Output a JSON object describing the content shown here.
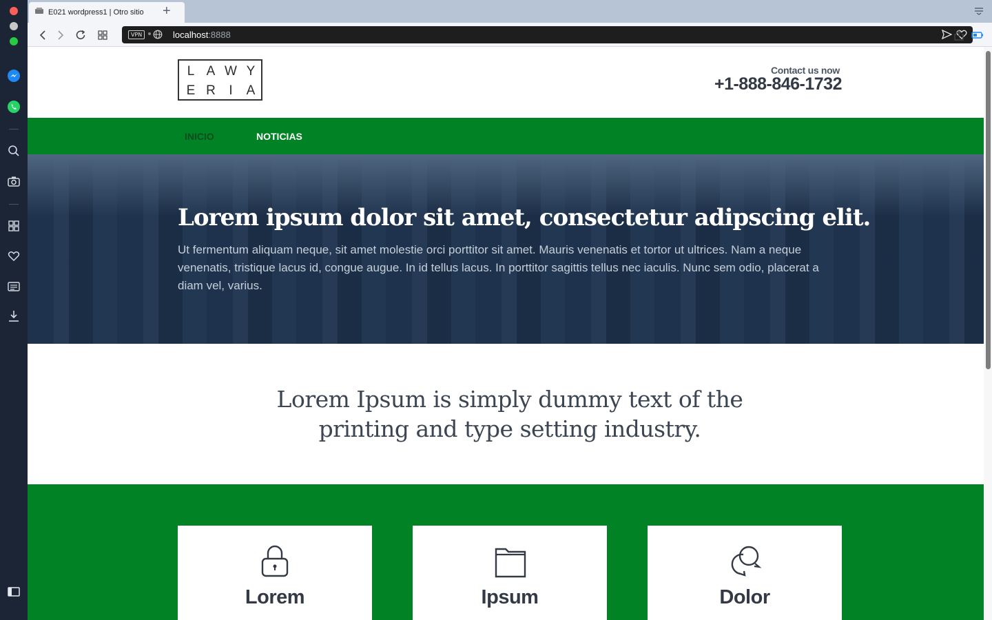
{
  "browser": {
    "tab_title": "E021 wordpress1 | Otro sitio",
    "new_tab_symbol": "+",
    "vpn_label": "VPN",
    "url_host": "localhost",
    "url_port": ":8888"
  },
  "site": {
    "logo_row1": [
      "L",
      "A",
      "W",
      "Y"
    ],
    "logo_row2": [
      "E",
      "R",
      "I",
      "A"
    ],
    "contact_label": "Contact us now",
    "contact_phone": "+1-888-846-1732"
  },
  "nav": {
    "items": [
      {
        "label": "INICIO",
        "color": "#0b4d1e"
      },
      {
        "label": "NOTICIAS",
        "color": "#ffffff"
      }
    ]
  },
  "hero": {
    "title": "Lorem ipsum dolor sit amet, consectetur adipscing elit.",
    "text": "Ut fermentum aliquam neque, sit amet molestie orci porttitor sit amet. Mauris venenatis et tortor ut ultrices. Nam a neque venenatis, tristique lacus id, congue augue. In id tellus lacus. In porttitor sagittis tellus nec iaculis. Nunc sem odio, placerat a diam vel, varius."
  },
  "intro": {
    "text": "Lorem Ipsum is simply dummy text of the printing and type setting industry."
  },
  "features": [
    {
      "title": "Lorem",
      "icon": "lock-icon"
    },
    {
      "title": "Ipsum",
      "icon": "folder-icon"
    },
    {
      "title": "Dolor",
      "icon": "chat-bubbles-icon"
    }
  ],
  "colors": {
    "brand_green": "#008225",
    "sidebar_bg": "#1b2536",
    "text_dark": "#333a45"
  }
}
